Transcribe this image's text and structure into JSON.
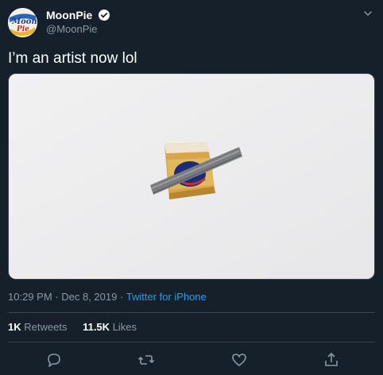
{
  "author": {
    "display_name": "MoonPie",
    "handle": "@MoonPie",
    "verified": true,
    "avatar_text_1": "Moon",
    "avatar_text_2": "Pie"
  },
  "tweet": {
    "text": "I’m an artist now lol",
    "media_alt": "MoonPie taped to a white wall"
  },
  "meta": {
    "time": "10:29 PM",
    "separator1": "·",
    "date": "Dec 8, 2019",
    "separator2": "·",
    "source": "Twitter for iPhone"
  },
  "stats": {
    "retweets_count": "1K",
    "retweets_label": "Retweets",
    "likes_count": "11.5K",
    "likes_label": "Likes"
  },
  "actions": [
    "reply-icon",
    "retweet-icon",
    "like-icon",
    "share-icon"
  ],
  "colors": {
    "background": "#15202b",
    "secondary_text": "#8899a6",
    "link": "#1da1f2",
    "divider": "#38444d"
  }
}
